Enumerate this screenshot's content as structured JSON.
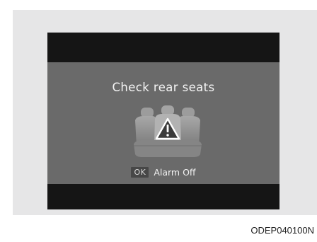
{
  "screen": {
    "title": "Check rear seats",
    "ok_label": "OK",
    "alarm_label": "Alarm Off",
    "icon": "rear-seats-warning-icon"
  },
  "caption": "ODEP040100N",
  "colors": {
    "panel_background": "#e6e6e7",
    "screen_background": "#6a6a6a",
    "bar_color": "#151515",
    "text_color": "#f4f4f4"
  }
}
